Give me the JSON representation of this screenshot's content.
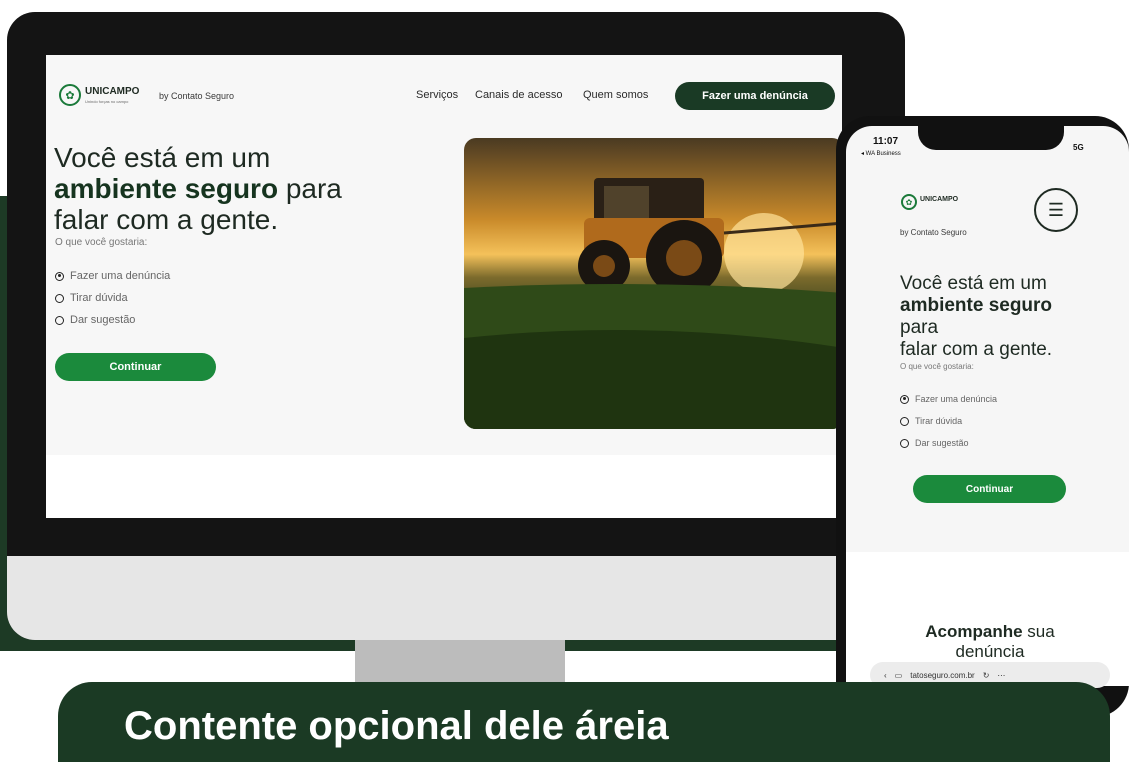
{
  "desktop": {
    "logo": {
      "name": "UNICAMPO",
      "tagline": "Unindo forças no campo"
    },
    "by_label": "by Contato Seguro",
    "nav": [
      "Serviços",
      "Canais de acesso",
      "Quem somos"
    ],
    "cta": "Fazer uma denúncia",
    "hero": {
      "line1": "Você está em um",
      "bold": "ambiente seguro",
      "rest": " para",
      "line3": "falar com a gente."
    },
    "question": "O que você gostaria:",
    "options": [
      "Fazer uma denúncia",
      "Tirar dúvida",
      "Dar sugestão"
    ],
    "selected_option": 0,
    "continue": "Continuar"
  },
  "phone": {
    "time": "11:07",
    "back_app": "◂ WA Business",
    "signal": "5G",
    "logo": {
      "name": "UNICAMPO"
    },
    "by_label": "by Contato Seguro",
    "hero": {
      "line1": "Você está em um",
      "bold": "ambiente seguro",
      "line3": "para",
      "line4": "falar com a gente."
    },
    "question": "O que você gostaria:",
    "options": [
      "Fazer uma denúncia",
      "Tirar dúvida",
      "Dar sugestão"
    ],
    "continue": "Continuar",
    "track": {
      "bold": "Acompanhe",
      "rest": " sua",
      "line2": "denúncia"
    },
    "url": "tatoseguro.com.br"
  },
  "banner": {
    "text": "Contente opcional dele áreia"
  },
  "colors": {
    "brand_green": "#1b8a3c",
    "dark_green": "#1a3a25"
  }
}
